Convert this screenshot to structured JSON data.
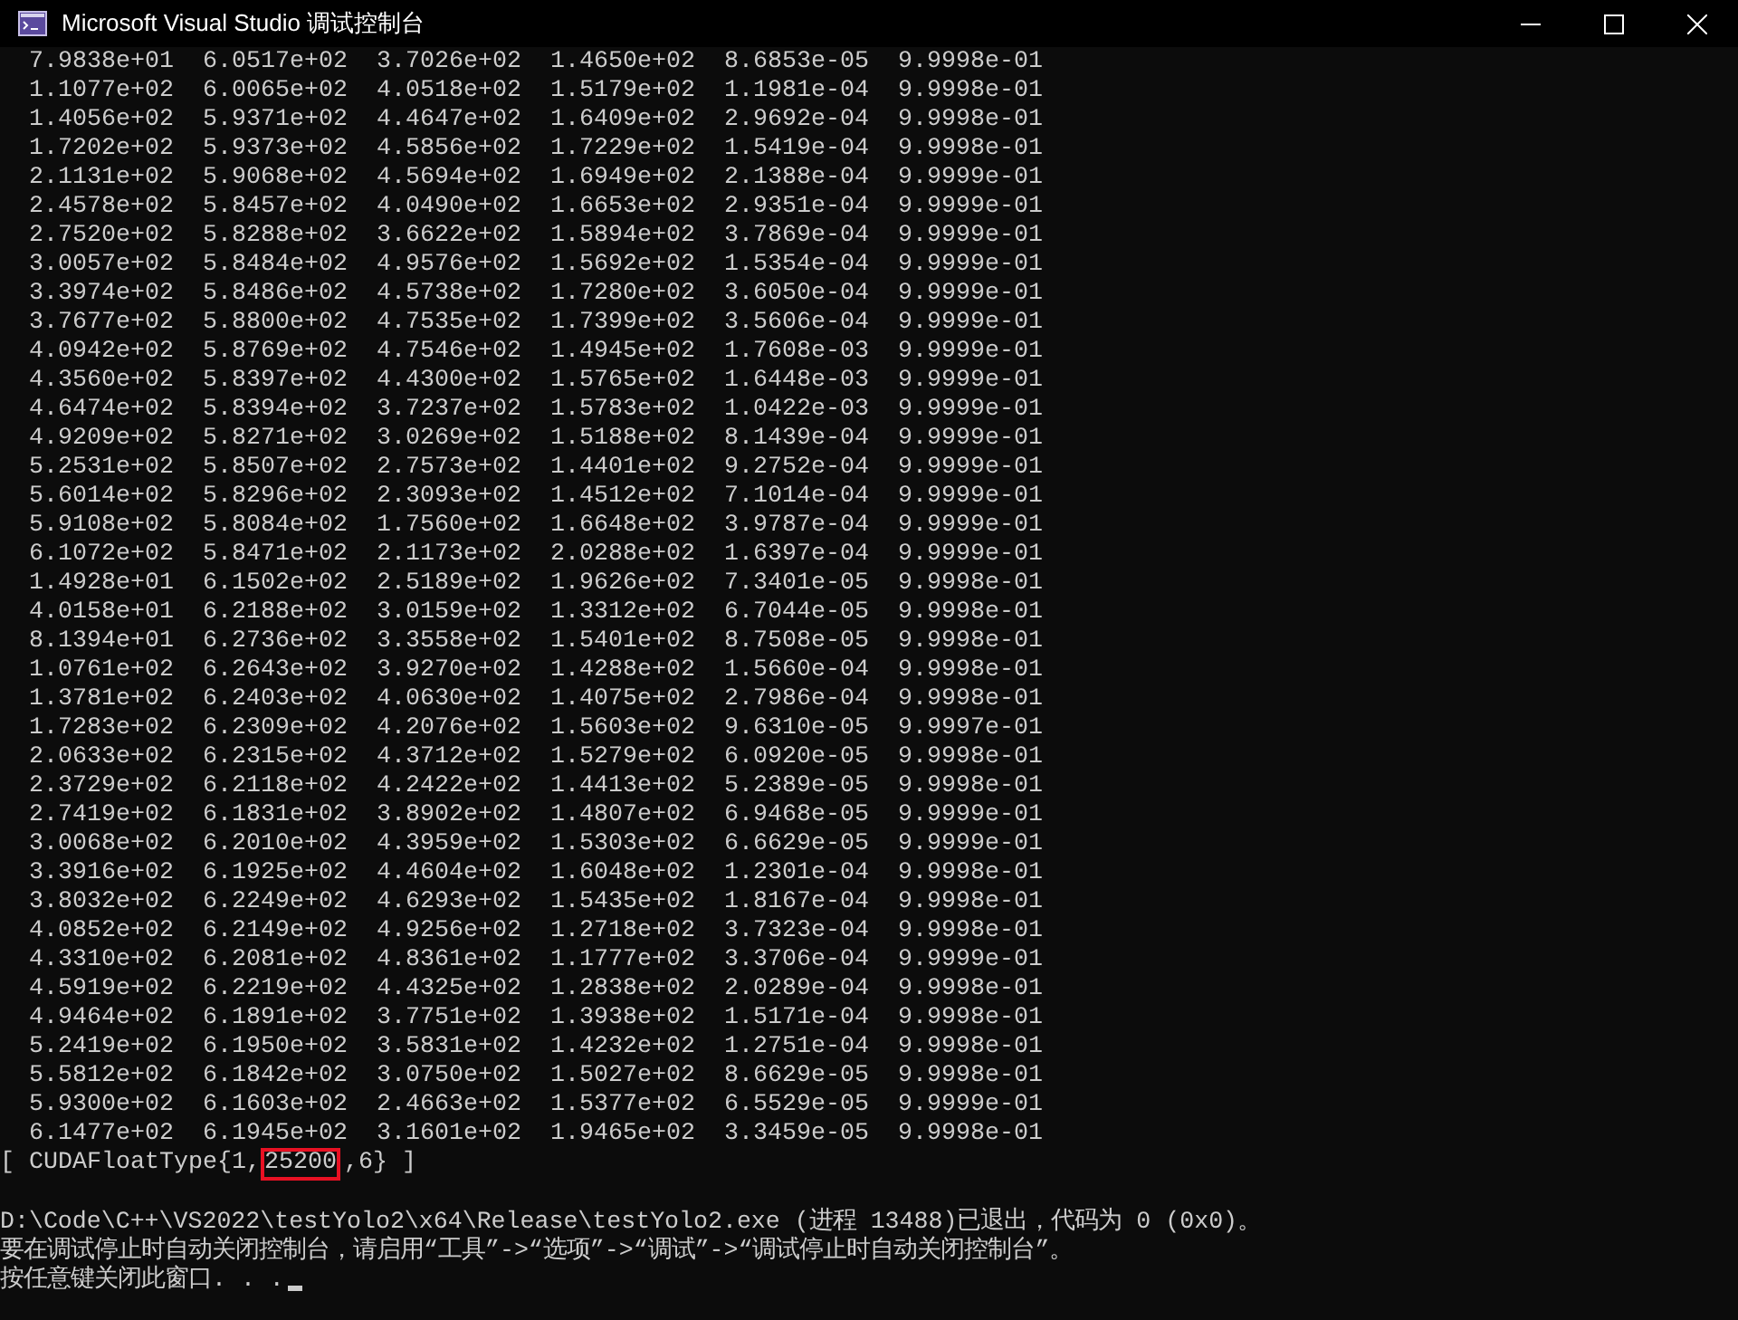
{
  "window": {
    "title": "Microsoft Visual Studio 调试控制台"
  },
  "rows": [
    [
      "7.9838e+01",
      "6.0517e+02",
      "3.7026e+02",
      "1.4650e+02",
      "8.6853e-05",
      "9.9998e-01"
    ],
    [
      "1.1077e+02",
      "6.0065e+02",
      "4.0518e+02",
      "1.5179e+02",
      "1.1981e-04",
      "9.9998e-01"
    ],
    [
      "1.4056e+02",
      "5.9371e+02",
      "4.4647e+02",
      "1.6409e+02",
      "2.9692e-04",
      "9.9998e-01"
    ],
    [
      "1.7202e+02",
      "5.9373e+02",
      "4.5856e+02",
      "1.7229e+02",
      "1.5419e-04",
      "9.9998e-01"
    ],
    [
      "2.1131e+02",
      "5.9068e+02",
      "4.5694e+02",
      "1.6949e+02",
      "2.1388e-04",
      "9.9999e-01"
    ],
    [
      "2.4578e+02",
      "5.8457e+02",
      "4.0490e+02",
      "1.6653e+02",
      "2.9351e-04",
      "9.9999e-01"
    ],
    [
      "2.7520e+02",
      "5.8288e+02",
      "3.6622e+02",
      "1.5894e+02",
      "3.7869e-04",
      "9.9999e-01"
    ],
    [
      "3.0057e+02",
      "5.8484e+02",
      "4.9576e+02",
      "1.5692e+02",
      "1.5354e-04",
      "9.9999e-01"
    ],
    [
      "3.3974e+02",
      "5.8486e+02",
      "4.5738e+02",
      "1.7280e+02",
      "3.6050e-04",
      "9.9999e-01"
    ],
    [
      "3.7677e+02",
      "5.8800e+02",
      "4.7535e+02",
      "1.7399e+02",
      "3.5606e-04",
      "9.9999e-01"
    ],
    [
      "4.0942e+02",
      "5.8769e+02",
      "4.7546e+02",
      "1.4945e+02",
      "1.7608e-03",
      "9.9999e-01"
    ],
    [
      "4.3560e+02",
      "5.8397e+02",
      "4.4300e+02",
      "1.5765e+02",
      "1.6448e-03",
      "9.9999e-01"
    ],
    [
      "4.6474e+02",
      "5.8394e+02",
      "3.7237e+02",
      "1.5783e+02",
      "1.0422e-03",
      "9.9999e-01"
    ],
    [
      "4.9209e+02",
      "5.8271e+02",
      "3.0269e+02",
      "1.5188e+02",
      "8.1439e-04",
      "9.9999e-01"
    ],
    [
      "5.2531e+02",
      "5.8507e+02",
      "2.7573e+02",
      "1.4401e+02",
      "9.2752e-04",
      "9.9999e-01"
    ],
    [
      "5.6014e+02",
      "5.8296e+02",
      "2.3093e+02",
      "1.4512e+02",
      "7.1014e-04",
      "9.9999e-01"
    ],
    [
      "5.9108e+02",
      "5.8084e+02",
      "1.7560e+02",
      "1.6648e+02",
      "3.9787e-04",
      "9.9999e-01"
    ],
    [
      "6.1072e+02",
      "5.8471e+02",
      "2.1173e+02",
      "2.0288e+02",
      "1.6397e-04",
      "9.9999e-01"
    ],
    [
      "1.4928e+01",
      "6.1502e+02",
      "2.5189e+02",
      "1.9626e+02",
      "7.3401e-05",
      "9.9998e-01"
    ],
    [
      "4.0158e+01",
      "6.2188e+02",
      "3.0159e+02",
      "1.3312e+02",
      "6.7044e-05",
      "9.9998e-01"
    ],
    [
      "8.1394e+01",
      "6.2736e+02",
      "3.3558e+02",
      "1.5401e+02",
      "8.7508e-05",
      "9.9998e-01"
    ],
    [
      "1.0761e+02",
      "6.2643e+02",
      "3.9270e+02",
      "1.4288e+02",
      "1.5660e-04",
      "9.9998e-01"
    ],
    [
      "1.3781e+02",
      "6.2403e+02",
      "4.0630e+02",
      "1.4075e+02",
      "2.7986e-04",
      "9.9998e-01"
    ],
    [
      "1.7283e+02",
      "6.2309e+02",
      "4.2076e+02",
      "1.5603e+02",
      "9.6310e-05",
      "9.9997e-01"
    ],
    [
      "2.0633e+02",
      "6.2315e+02",
      "4.3712e+02",
      "1.5279e+02",
      "6.0920e-05",
      "9.9998e-01"
    ],
    [
      "2.3729e+02",
      "6.2118e+02",
      "4.2422e+02",
      "1.4413e+02",
      "5.2389e-05",
      "9.9998e-01"
    ],
    [
      "2.7419e+02",
      "6.1831e+02",
      "3.8902e+02",
      "1.4807e+02",
      "6.9468e-05",
      "9.9999e-01"
    ],
    [
      "3.0068e+02",
      "6.2010e+02",
      "4.3959e+02",
      "1.5303e+02",
      "6.6629e-05",
      "9.9999e-01"
    ],
    [
      "3.3916e+02",
      "6.1925e+02",
      "4.4604e+02",
      "1.6048e+02",
      "1.2301e-04",
      "9.9998e-01"
    ],
    [
      "3.8032e+02",
      "6.2249e+02",
      "4.6293e+02",
      "1.5435e+02",
      "1.8167e-04",
      "9.9998e-01"
    ],
    [
      "4.0852e+02",
      "6.2149e+02",
      "4.9256e+02",
      "1.2718e+02",
      "3.7323e-04",
      "9.9998e-01"
    ],
    [
      "4.3310e+02",
      "6.2081e+02",
      "4.8361e+02",
      "1.1777e+02",
      "3.3706e-04",
      "9.9999e-01"
    ],
    [
      "4.5919e+02",
      "6.2219e+02",
      "4.4325e+02",
      "1.2838e+02",
      "2.0289e-04",
      "9.9998e-01"
    ],
    [
      "4.9464e+02",
      "6.1891e+02",
      "3.7751e+02",
      "1.3938e+02",
      "1.5171e-04",
      "9.9998e-01"
    ],
    [
      "5.2419e+02",
      "6.1950e+02",
      "3.5831e+02",
      "1.4232e+02",
      "1.2751e-04",
      "9.9998e-01"
    ],
    [
      "5.5812e+02",
      "6.1842e+02",
      "3.0750e+02",
      "1.5027e+02",
      "8.6629e-05",
      "9.9998e-01"
    ],
    [
      "5.9300e+02",
      "6.1603e+02",
      "2.4663e+02",
      "1.5377e+02",
      "6.5529e-05",
      "9.9999e-01"
    ],
    [
      "6.1477e+02",
      "6.1945e+02",
      "3.1601e+02",
      "1.9465e+02",
      "3.3459e-05",
      "9.9998e-01"
    ]
  ],
  "tensor_type": {
    "prefix": "[ CUDAFloatType{1,",
    "highlighted": "25200",
    "suffix": ",6} ]"
  },
  "messages": [
    "D:\\Code\\C++\\VS2022\\testYolo2\\x64\\Release\\testYolo2.exe (进程 13488)已退出，代码为 0 (0x0)。",
    "要在调试停止时自动关闭控制台，请启用“工具”->“选项”->“调试”->“调试停止时自动关闭控制台”。",
    "按任意键关闭此窗口. . ."
  ]
}
